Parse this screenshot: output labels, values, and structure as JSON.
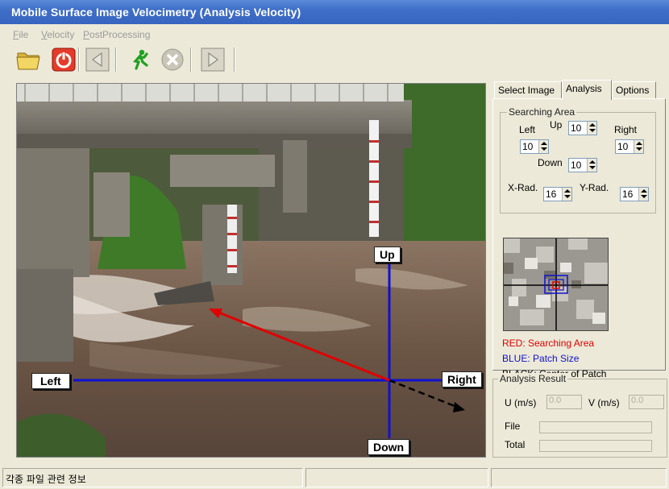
{
  "window": {
    "title": "Mobile Surface Image Velocimetry (Analysis Velocity)"
  },
  "menu": [
    {
      "label": "File",
      "mnemonic": "F"
    },
    {
      "label": "Velocity",
      "mnemonic": "V"
    },
    {
      "label": "PostProcessing",
      "mnemonic": "P"
    }
  ],
  "toolbar": {
    "icons": [
      "folder-open-icon",
      "power-icon",
      "step-back-icon",
      "run-icon",
      "stop-icon",
      "step-forward-icon"
    ]
  },
  "viewer": {
    "labels": {
      "up": "Up",
      "down": "Down",
      "left": "Left",
      "right": "Right"
    }
  },
  "tabs": [
    "Select Image",
    "Analysis",
    "Options"
  ],
  "active_tab": "Analysis",
  "searching_area": {
    "legend": "Searching Area",
    "up_label": "Up",
    "down_label": "Down",
    "left_label": "Left",
    "right_label": "Right",
    "xrad_label": "X-Rad.",
    "yrad_label": "Y-Rad.",
    "up": "10",
    "down": "10",
    "left": "10",
    "right": "10",
    "xrad": "16",
    "yrad": "16"
  },
  "legend_text": {
    "red": "RED: Searching Area",
    "blue": "BLUE: Patch Size",
    "black": "BLACK: Center of Patch"
  },
  "colors": {
    "red": "#e00000",
    "blue": "#1010d0",
    "black": "#000000"
  },
  "analysis_result": {
    "legend": "Analysis Result",
    "u_label": "U (m/s)",
    "v_label": "V (m/s)",
    "u_value": "0.0",
    "v_value": "0.0",
    "file_label": "File",
    "total_label": "Total"
  },
  "status": {
    "text": "각종 파일 관련 정보"
  }
}
